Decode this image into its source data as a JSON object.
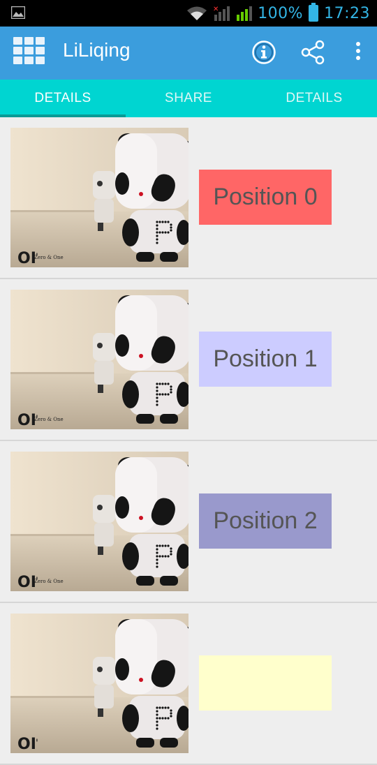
{
  "status_bar": {
    "battery_percent": "100%",
    "time": "17:23",
    "icons": [
      "image-icon",
      "wifi-icon",
      "signal-no-service-icon",
      "signal-icon",
      "battery-icon"
    ],
    "color": "#33b5e5"
  },
  "action_bar": {
    "title": "LiLiqing",
    "background": "#3b9ddd",
    "icons": [
      "app-grid-icon",
      "info-icon",
      "share-icon",
      "overflow-menu-icon"
    ]
  },
  "tabs": {
    "background": "#00d5d1",
    "items": [
      {
        "label": "DETAILS",
        "selected": true
      },
      {
        "label": "SHARE",
        "selected": false
      },
      {
        "label": "DETAILS",
        "selected": false
      }
    ]
  },
  "list": {
    "items": [
      {
        "label": "Position 0",
        "color": "#ff6666",
        "image_caption": "Zero & One"
      },
      {
        "label": "Position 1",
        "color": "#ccccff",
        "image_caption": "Zero & One"
      },
      {
        "label": "Position 2",
        "color": "#9999cc",
        "image_caption": "Zero & One"
      },
      {
        "label": "",
        "color": "#ffffcc",
        "image_caption": ""
      }
    ]
  }
}
